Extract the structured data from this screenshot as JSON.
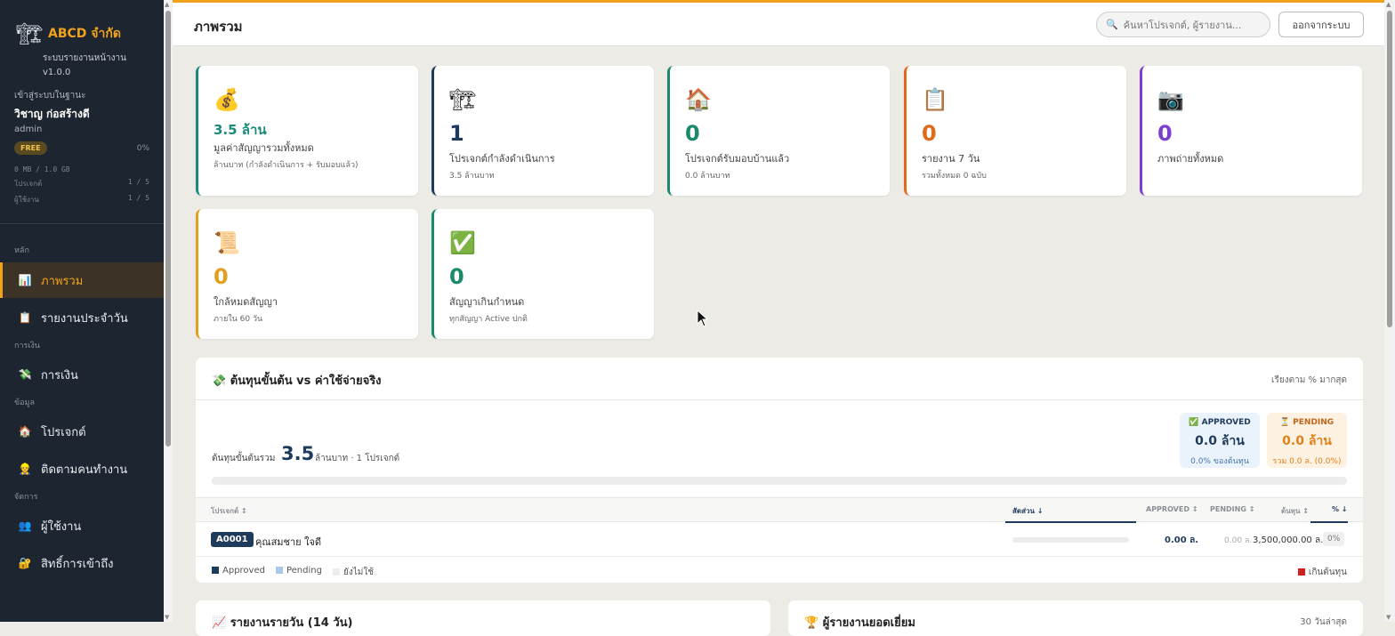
{
  "sidebar": {
    "brand": "ABCD จำกัด",
    "subtitle": "ระบบรายงานหน้างาน",
    "version": "v1.0.0",
    "login_as_label": "เข้าสู่ระบบในฐานะ",
    "user_name": "วิชาญ ก่อสร้างดี",
    "user_role": "admin",
    "plan": "FREE",
    "plan_percent": "0%",
    "storage": "0 MB / 1.0 GB",
    "projects_label": "โปรเจกต์",
    "projects_value": "1 / 5",
    "users_label": "ผู้ใช้งาน",
    "users_value": "1 / 5",
    "sections": {
      "main": "หลัก",
      "finance": "การเงิน",
      "data": "ข้อมูล",
      "manage": "จัดการ"
    },
    "items": {
      "overview": "ภาพรวม",
      "daily": "รายงานประจำวัน",
      "finance": "การเงิน",
      "projects": "โปรเจกต์",
      "tracking": "ติดตามคนทำงาน",
      "users": "ผู้ใช้งาน",
      "access": "สิทธิ์การเข้าถึง"
    }
  },
  "header": {
    "title": "ภาพรวม",
    "search_placeholder": "ค้นหาโปรเจกต์, ผู้รายงาน...",
    "logout": "ออกจากระบบ"
  },
  "stats": [
    {
      "icon": "money-bag-icon",
      "value": "3.5 ล้าน",
      "label": "มูลค่าสัญญารวมทั้งหมด",
      "sub": "ล้านบาท (กำลังดำเนินการ + รับมอบแล้ว)",
      "color": "#1a8a7a"
    },
    {
      "icon": "crane-icon",
      "value": "1",
      "label": "โปรเจกต์กำลังดำเนินการ",
      "sub": "3.5 ล้านบาท",
      "color": "#1f3b5c"
    },
    {
      "icon": "house-icon",
      "value": "0",
      "label": "โปรเจกต์รับมอบบ้านแล้ว",
      "sub": "0.0 ล้านบาท",
      "color": "#1a8a6a"
    },
    {
      "icon": "clipboard-icon",
      "value": "0",
      "label": "รายงาน 7 วัน",
      "sub": "รวมทั้งหมด 0 ฉบับ",
      "color": "#e06a1a"
    },
    {
      "icon": "camera-icon",
      "value": "0",
      "label": "ภาพถ่ายทั้งหมด",
      "sub": "",
      "color": "#7d3fd0"
    },
    {
      "icon": "scroll-icon",
      "value": "0",
      "label": "ใกล้หมดสัญญา",
      "sub": "ภายใน 60 วัน",
      "color": "#e0a020"
    },
    {
      "icon": "check-icon",
      "value": "0",
      "label": "สัญญาเกินกำหนด",
      "sub": "ทุกสัญญา Active ปกติ",
      "color": "#1a8a6a"
    }
  ],
  "cost_panel": {
    "title": "ต้นทุนขั้นต้น vs ค่าใช้จ่ายจริง",
    "sort_note": "เรียงตาม % มากสุด",
    "total_label": "ต้นทุนขั้นต้นรวม",
    "total_value": "3.5",
    "total_unit": "ล้านบาท · 1 โปรเจกต์",
    "approved": {
      "title": "APPROVED",
      "value": "0.0 ล้าน",
      "sub": "0.0% ของต้นทุน"
    },
    "pending": {
      "title": "PENDING",
      "value": "0.0 ล้าน",
      "sub": "รวม 0.0 ล. (0.0%)"
    },
    "progress_fraction": 0.0,
    "columns": [
      "โปรเจกต์ ↕",
      "สัดส่วน ↓",
      "APPROVED ↕",
      "PENDING ↕",
      "ต้นทุน ↕",
      "% ↓"
    ],
    "rows": [
      {
        "code": "A0001",
        "name": "คุณสมชาย ใจดี",
        "share": 0.0,
        "approved": "0.00 ล.",
        "pending": "0.00 ล.",
        "cost": "3,500,000.00 ล.",
        "percent": "0%"
      }
    ],
    "legend": {
      "approved": "Approved",
      "pending": "Pending",
      "unused": "ยังไม่ใช้",
      "over": "เกินต้นทุน"
    }
  },
  "bottom": {
    "left_title": "รายงานรายวัน (14 วัน)",
    "right_title": "ผู้รายงานยอดเยี่ยม",
    "right_note": "30 วันล่าสุด"
  },
  "colors": {
    "accent": "#f0a21c",
    "navy": "#1f3b5c",
    "sidebar": "#1d2530"
  }
}
